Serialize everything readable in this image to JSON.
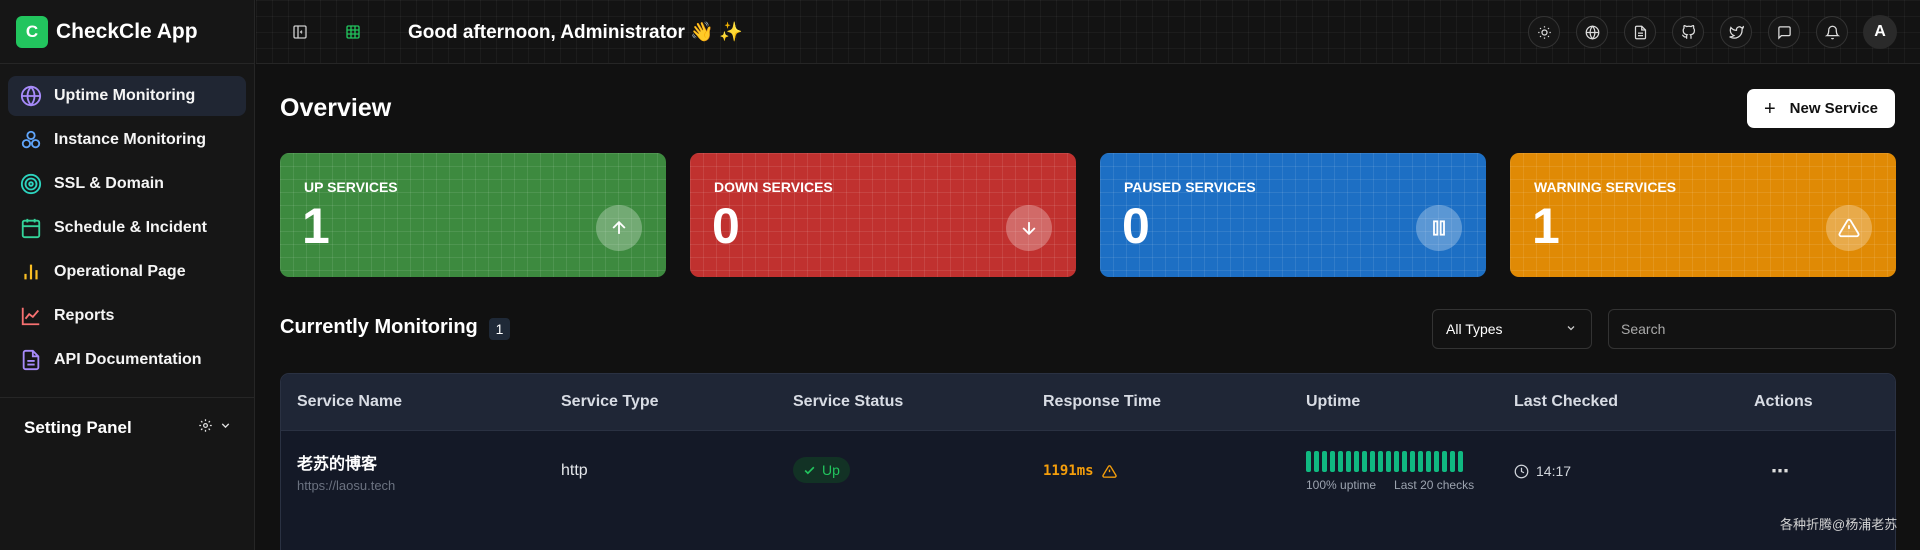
{
  "app": {
    "logo_letter": "C",
    "name": "CheckCle App"
  },
  "sidebar": {
    "items": [
      {
        "label": "Uptime Monitoring",
        "icon": "globe-icon",
        "color": "#a78bfa",
        "active": true
      },
      {
        "label": "Instance Monitoring",
        "icon": "boxes-icon",
        "color": "#60a5fa"
      },
      {
        "label": "SSL & Domain",
        "icon": "radar-icon",
        "color": "#2dd4bf"
      },
      {
        "label": "Schedule & Incident",
        "icon": "calendar-icon",
        "color": "#34d399"
      },
      {
        "label": "Operational Page",
        "icon": "bar-chart-icon",
        "color": "#fbbf24"
      },
      {
        "label": "Reports",
        "icon": "line-chart-icon",
        "color": "#f87171"
      },
      {
        "label": "API Documentation",
        "icon": "file-icon",
        "color": "#a78bfa"
      }
    ],
    "setting_label": "Setting Panel"
  },
  "topbar": {
    "greeting": "Good afternoon, Administrator",
    "greeting_emoji": "👋 ✨",
    "avatar_letter": "A"
  },
  "main": {
    "title": "Overview",
    "new_service_label": "New Service",
    "cards": [
      {
        "label": "UP SERVICES",
        "value": "1",
        "color": "#3d8a3f",
        "icon": "arrow-up-icon"
      },
      {
        "label": "DOWN SERVICES",
        "value": "0",
        "color": "#c0312f",
        "icon": "arrow-down-icon"
      },
      {
        "label": "PAUSED SERVICES",
        "value": "0",
        "color": "#1d6fc4",
        "icon": "pause-icon"
      },
      {
        "label": "WARNING SERVICES",
        "value": "1",
        "color": "#e08a05",
        "icon": "warning-icon"
      }
    ],
    "monitoring_title": "Currently Monitoring",
    "monitoring_count": "1",
    "filter_selected": "All Types",
    "search_placeholder": "Search"
  },
  "table": {
    "headers": [
      "Service Name",
      "Service Type",
      "Service Status",
      "Response Time",
      "Uptime",
      "Last Checked",
      "Actions"
    ],
    "rows": [
      {
        "name": "老苏的博客",
        "url": "https://laosu.tech",
        "type": "http",
        "status": "Up",
        "response_time": "1191ms",
        "uptime_checks": 20,
        "uptime_percent": "100% uptime",
        "uptime_window": "Last 20 checks",
        "last_checked": "14:17",
        "actions": "⋯"
      }
    ]
  },
  "watermark": "各种折腾@杨浦老苏"
}
